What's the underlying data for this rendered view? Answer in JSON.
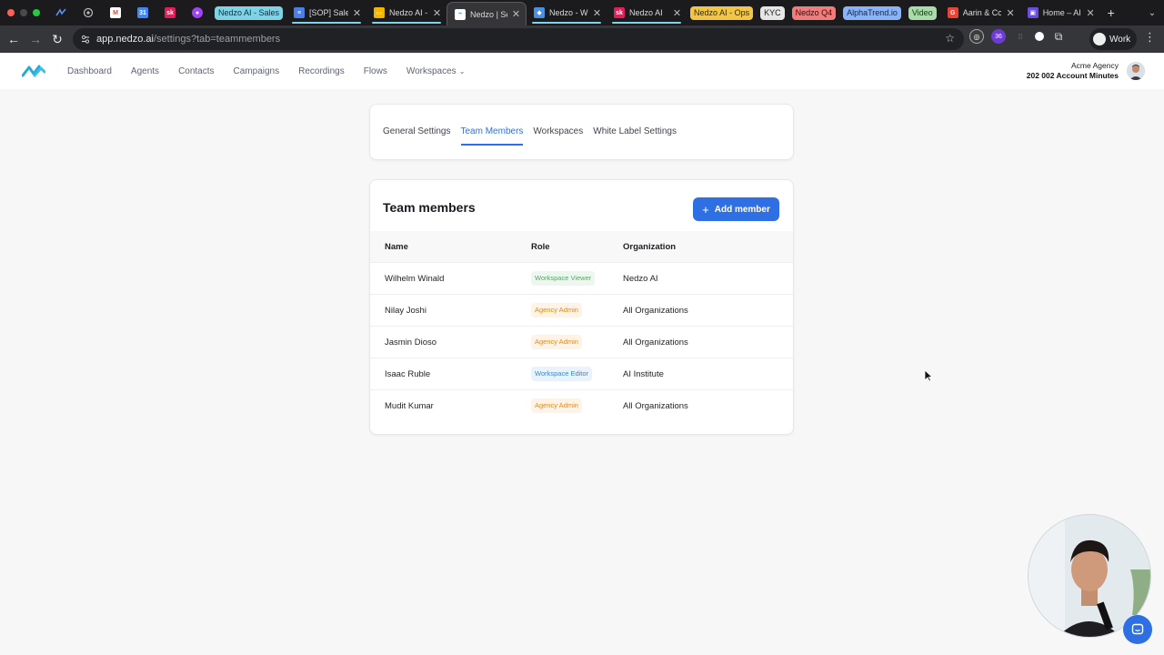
{
  "browser": {
    "pinned_tabs": [
      {
        "icon": "nedzo-logo-icon",
        "color": "#2f6fe4"
      },
      {
        "icon": "openai-icon",
        "color": "#9a9a9a"
      },
      {
        "icon": "gmail-icon",
        "color": "#ea4335"
      },
      {
        "icon": "calendar-icon",
        "color": "#4285f4"
      },
      {
        "icon": "slack-k-icon",
        "color": "#e01e5a"
      },
      {
        "icon": "chrome-app-icon",
        "color": "#a142f4"
      }
    ],
    "tab_groups": {
      "sales": {
        "label": "Nedzo AI - Sales",
        "color": "#7fd3e6"
      },
      "ops": {
        "label": "Nedzo AI - Ops",
        "color": "#f3c545"
      },
      "kyc": {
        "label": "KYC",
        "color": "#e6e6e6"
      },
      "q4": {
        "label": "Nedzo Q4",
        "color": "#f07c7c"
      },
      "alphatrend": {
        "label": "AlphaTrend.io",
        "color": "#8ab4f8"
      },
      "video": {
        "label": "Video",
        "color": "#a8dca8"
      }
    },
    "tabs": [
      {
        "title": "[SOP] Sale",
        "icon_color": "#4a7fe8",
        "underline": "#7fd3e6"
      },
      {
        "title": "Nedzo AI -",
        "icon_color": "#f4b400",
        "underline": "#7fd3e6"
      },
      {
        "title": "Nedzo | Se",
        "icon_color": "#ffffff",
        "underline": "#7fd3e6",
        "active": true
      },
      {
        "title": "Nedzo - W",
        "icon_color": "#4a90e2",
        "underline": "#7fd3e6"
      },
      {
        "title": "Nedzo AI",
        "icon_color": "#e01e5a",
        "underline": "#7fd3e6"
      },
      {
        "title": "Aarin & Co",
        "icon_color": "#ea4335",
        "underline": ""
      },
      {
        "title": "Home – AI",
        "icon_color": "#6b4de6",
        "underline": ""
      }
    ],
    "url_host": "app.nedzo.ai",
    "url_path": "/settings?tab=teammembers",
    "profile_label": "Work",
    "extension_badge": "36"
  },
  "nav": {
    "items": [
      "Dashboard",
      "Agents",
      "Contacts",
      "Campaigns",
      "Recordings",
      "Flows"
    ],
    "workspaces": "Workspaces"
  },
  "account": {
    "org": "Acme Agency",
    "minutes": "202 002 Account Minutes"
  },
  "settings_tabs": [
    {
      "label": "General Settings",
      "active": false
    },
    {
      "label": "Team Members",
      "active": true
    },
    {
      "label": "Workspaces",
      "active": false
    },
    {
      "label": "White Label Settings",
      "active": false
    }
  ],
  "team": {
    "title": "Team members",
    "add_button": "Add member",
    "columns": [
      "Name",
      "Role",
      "Organization"
    ],
    "members": [
      {
        "name": "Wilhelm Winald",
        "role": "Workspace Viewer",
        "role_fg": "#5aa466",
        "role_bg": "#eef7ef",
        "organization": "Nedzo AI"
      },
      {
        "name": "Nilay Joshi",
        "role": "Agency Admin",
        "role_fg": "#e08a1e",
        "role_bg": "#fdf4e7",
        "organization": "All Organizations"
      },
      {
        "name": "Jasmin Dioso",
        "role": "Agency Admin",
        "role_fg": "#e08a1e",
        "role_bg": "#fdf4e7",
        "organization": "All Organizations"
      },
      {
        "name": "Isaac Ruble",
        "role": "Workspace Editor",
        "role_fg": "#3a86c8",
        "role_bg": "#eaf3fb",
        "organization": "AI Institute"
      },
      {
        "name": "Mudit Kumar",
        "role": "Agency Admin",
        "role_fg": "#e08a1e",
        "role_bg": "#fdf4e7",
        "organization": "All Organizations"
      }
    ]
  },
  "colors": {
    "accent": "#2f6fe4"
  }
}
